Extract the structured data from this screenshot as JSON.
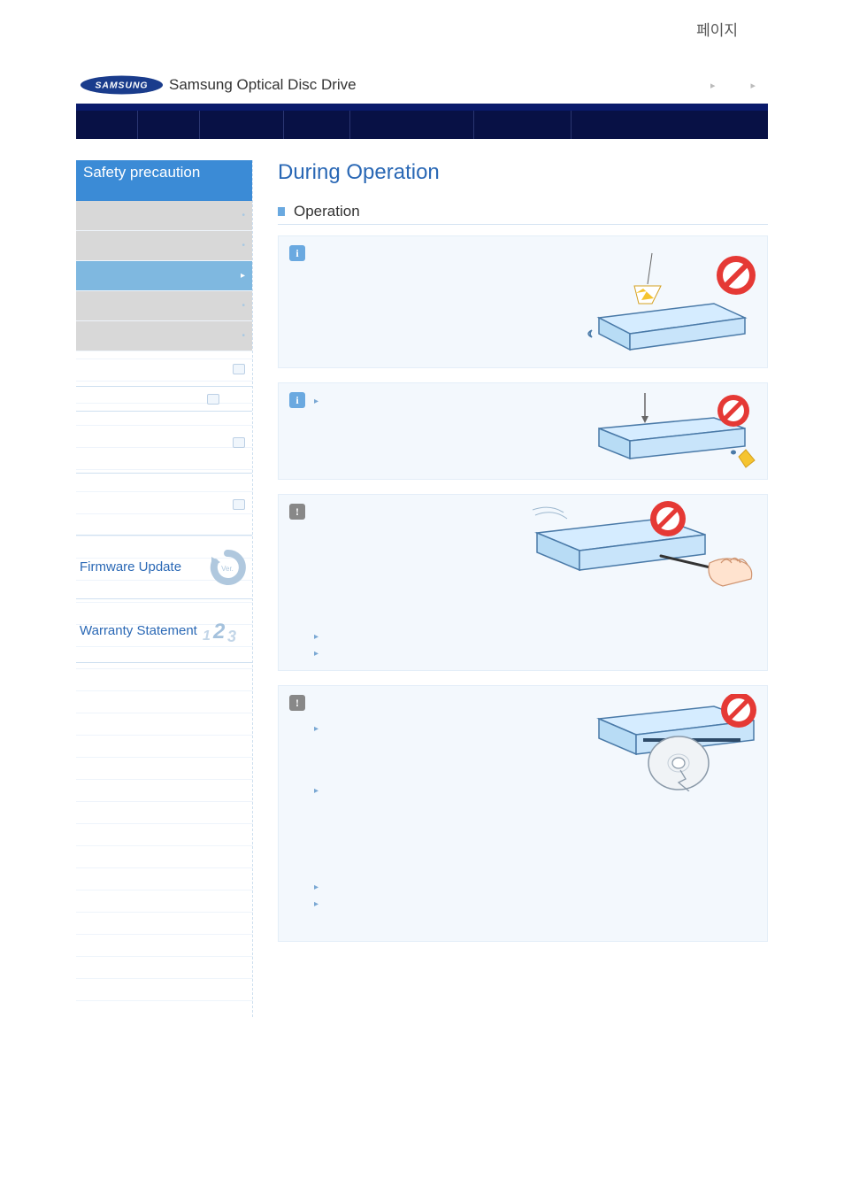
{
  "header": {
    "top_label": "페이지",
    "brand": "Samsung Optical Disc Drive"
  },
  "sidebar": {
    "title": "Safety precaution",
    "items": [
      {
        "label": "",
        "active": false
      },
      {
        "label": "",
        "active": false
      },
      {
        "label": "",
        "active": true
      },
      {
        "label": "",
        "active": false
      },
      {
        "label": "",
        "active": false
      }
    ],
    "promos": [
      {
        "label": "Firmware Update"
      },
      {
        "label": "Warranty Statement"
      }
    ]
  },
  "main": {
    "title": "During Operation",
    "section": "Operation",
    "blocks": [
      {
        "type": "info",
        "lines": []
      },
      {
        "type": "info",
        "lines": [
          ""
        ]
      },
      {
        "type": "warn",
        "lines": [
          "",
          ""
        ]
      },
      {
        "type": "warn",
        "lines": [
          "",
          "",
          "",
          ""
        ]
      }
    ]
  }
}
